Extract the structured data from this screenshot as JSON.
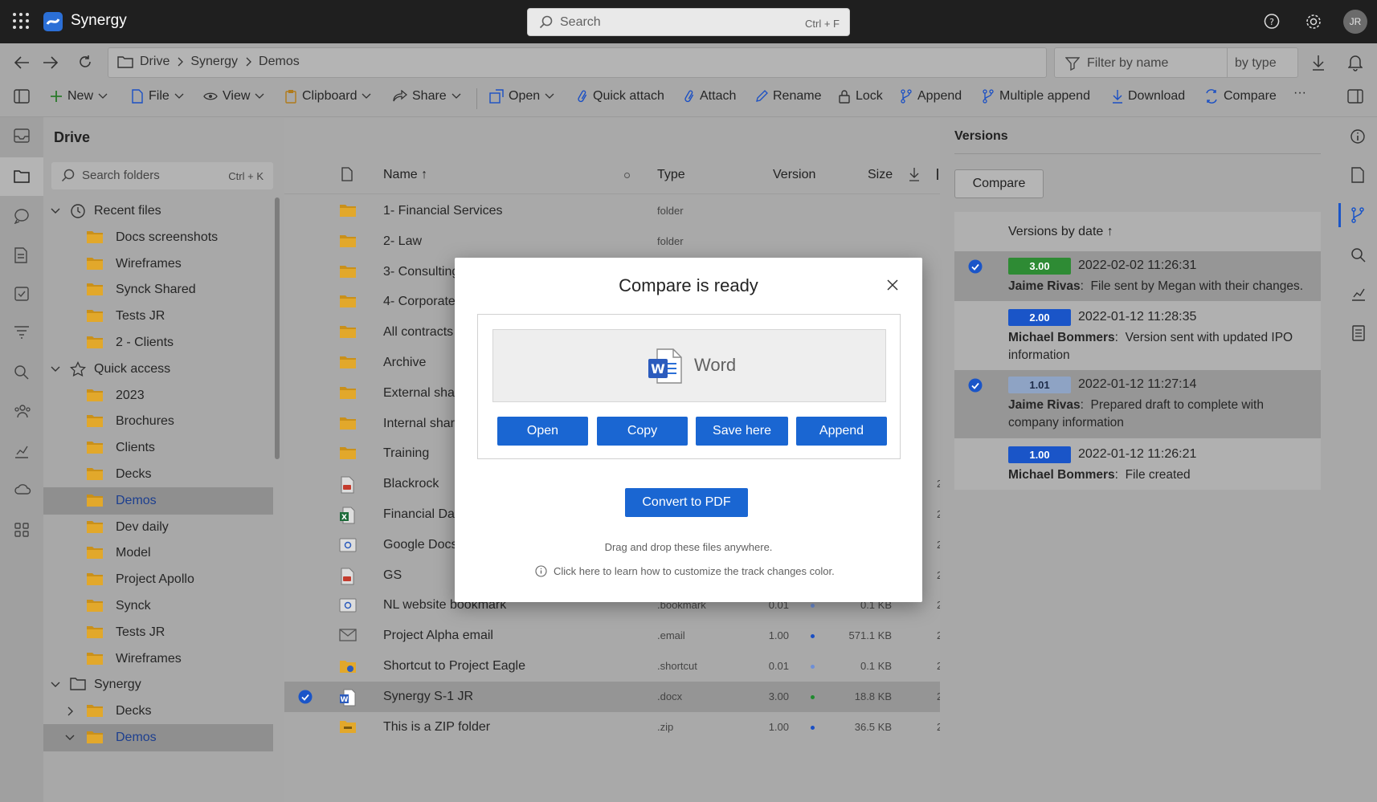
{
  "app": {
    "title": "Synergy",
    "avatar_initials": "JR"
  },
  "search": {
    "placeholder": "Search",
    "shortcut": "Ctrl + F"
  },
  "breadcrumb": [
    "Drive",
    "Synergy",
    "Demos"
  ],
  "filter": {
    "placeholder": "Filter by name",
    "type_label": "by type"
  },
  "toolbar": {
    "new": "New",
    "file": "File",
    "view": "View",
    "clipboard": "Clipboard",
    "share": "Share",
    "open": "Open",
    "quick_attach": "Quick attach",
    "attach": "Attach",
    "rename": "Rename",
    "lock": "Lock",
    "append": "Append",
    "multiple_append": "Multiple append",
    "download": "Download",
    "compare": "Compare",
    "more": "···"
  },
  "folders": {
    "title": "Drive",
    "search_placeholder": "Search folders",
    "search_shortcut": "Ctrl + K",
    "items": [
      {
        "label": "Recent files",
        "level": 0,
        "kind": "recent",
        "expanded": true
      },
      {
        "label": "Docs screenshots",
        "level": 1,
        "kind": "folder"
      },
      {
        "label": "Wireframes",
        "level": 1,
        "kind": "folder"
      },
      {
        "label": "Synck Shared",
        "level": 1,
        "kind": "folder"
      },
      {
        "label": "Tests JR",
        "level": 1,
        "kind": "folder"
      },
      {
        "label": "2 - Clients",
        "level": 1,
        "kind": "folder"
      },
      {
        "label": "Quick access",
        "level": 0,
        "kind": "star",
        "expanded": true
      },
      {
        "label": "2023",
        "level": 1,
        "kind": "folder"
      },
      {
        "label": "Brochures",
        "level": 1,
        "kind": "folder"
      },
      {
        "label": "Clients",
        "level": 1,
        "kind": "folder"
      },
      {
        "label": "Decks",
        "level": 1,
        "kind": "folder"
      },
      {
        "label": "Demos",
        "level": 1,
        "kind": "folder",
        "selected": true
      },
      {
        "label": "Dev daily",
        "level": 1,
        "kind": "folder"
      },
      {
        "label": "Model",
        "level": 1,
        "kind": "folder"
      },
      {
        "label": "Project Apollo",
        "level": 1,
        "kind": "folder"
      },
      {
        "label": "Synck",
        "level": 1,
        "kind": "folder"
      },
      {
        "label": "Tests JR",
        "level": 1,
        "kind": "folder"
      },
      {
        "label": "Wireframes",
        "level": 1,
        "kind": "folder"
      },
      {
        "label": "Synergy",
        "level": 0,
        "kind": "drive",
        "expanded": true
      },
      {
        "label": "Decks",
        "level": 1,
        "kind": "folder",
        "collapsed": true
      },
      {
        "label": "Demos",
        "level": 1,
        "kind": "folder",
        "expanded": true,
        "selected": true
      }
    ]
  },
  "files": {
    "columns": {
      "name": "Name ↑",
      "type": "Type",
      "version": "Version",
      "size": "Size"
    },
    "rows": [
      {
        "name": "1- Financial Services",
        "type": "folder",
        "version": "",
        "size": "",
        "icon": "folder"
      },
      {
        "name": "2- Law",
        "type": "folder",
        "version": "",
        "size": "",
        "icon": "folder"
      },
      {
        "name": "3- Consulting",
        "type": "",
        "version": "",
        "size": "",
        "icon": "folder"
      },
      {
        "name": "4- Corporate",
        "type": "",
        "version": "",
        "size": "",
        "icon": "folder"
      },
      {
        "name": "All contracts",
        "type": "",
        "version": "",
        "size": "",
        "icon": "folder"
      },
      {
        "name": "Archive",
        "type": "",
        "version": "",
        "size": "",
        "icon": "folder"
      },
      {
        "name": "External shari",
        "type": "",
        "version": "",
        "size": "",
        "icon": "folder"
      },
      {
        "name": "Internal shari",
        "type": "",
        "version": "",
        "size": "",
        "icon": "folder"
      },
      {
        "name": "Training",
        "type": "",
        "version": "",
        "size": "",
        "icon": "folder"
      },
      {
        "name": "Blackrock",
        "type": "",
        "version": "",
        "size": "",
        "icon": "pdf",
        "date": "2"
      },
      {
        "name": "Financial Data",
        "type": "",
        "version": "",
        "size": "",
        "icon": "excel",
        "date": "2"
      },
      {
        "name": "Google Docs",
        "type": "",
        "version": "",
        "size": "",
        "icon": "link",
        "date": "2"
      },
      {
        "name": "GS",
        "type": "",
        "version": "",
        "size": "",
        "icon": "pdf",
        "date": "2"
      },
      {
        "name": "NL website bookmark",
        "type": ".bookmark",
        "version": "0.01",
        "size": "0.1 KB",
        "icon": "link",
        "dot": "#6e8fd6",
        "date": "2"
      },
      {
        "name": "Project Alpha email",
        "type": ".email",
        "version": "1.00",
        "size": "571.1 KB",
        "icon": "email",
        "dot": "#1a4fc4",
        "date": "2"
      },
      {
        "name": "Shortcut to Project Eagle",
        "type": ".shortcut",
        "version": "0.01",
        "size": "0.1 KB",
        "icon": "shortcut",
        "dot": "#6e8fd6",
        "date": "2"
      },
      {
        "name": "Synergy S-1 JR",
        "type": ".docx",
        "version": "3.00",
        "size": "18.8 KB",
        "icon": "word",
        "dot": "#1f8a2e",
        "selected": true,
        "date": "2"
      },
      {
        "name": "This is a ZIP folder",
        "type": ".zip",
        "version": "1.00",
        "size": "36.5 KB",
        "icon": "zip",
        "dot": "#1a4fc4",
        "date": "2"
      }
    ]
  },
  "versions": {
    "title": "Versions",
    "compare_label": "Compare",
    "header": "Versions by date ↑",
    "items": [
      {
        "badge": "3.00",
        "color": "#2e8b34",
        "date": "2022-02-02 11:26:31",
        "author": "Jaime Rivas",
        "comment": "File sent by Megan with their changes.",
        "selected": true
      },
      {
        "badge": "2.00",
        "color": "#1a55c8",
        "date": "2022-01-12 11:28:35",
        "author": "Michael Bommers",
        "comment": "Version sent with updated IPO information",
        "selected": false
      },
      {
        "badge": "1.01",
        "color": "#8ea3c4",
        "date": "2022-01-12 11:27:14",
        "author": "Jaime Rivas",
        "comment": "Prepared draft to complete with company information",
        "selected": true
      },
      {
        "badge": "1.00",
        "color": "#1a55c8",
        "date": "2022-01-12 11:26:21",
        "author": "Michael Bommers",
        "comment": "File created",
        "selected": false
      }
    ]
  },
  "modal": {
    "title": "Compare is ready",
    "file_label": "Word",
    "open": "Open",
    "copy": "Copy",
    "save_here": "Save here",
    "append": "Append",
    "convert": "Convert to PDF",
    "drag_hint": "Drag and drop these files anywhere.",
    "track_hint": "Click here to learn how to customize the track changes color."
  },
  "colors": {
    "accent": "#1a66d2",
    "folder": "#e8a317",
    "topbar": "#1f1f1f"
  }
}
